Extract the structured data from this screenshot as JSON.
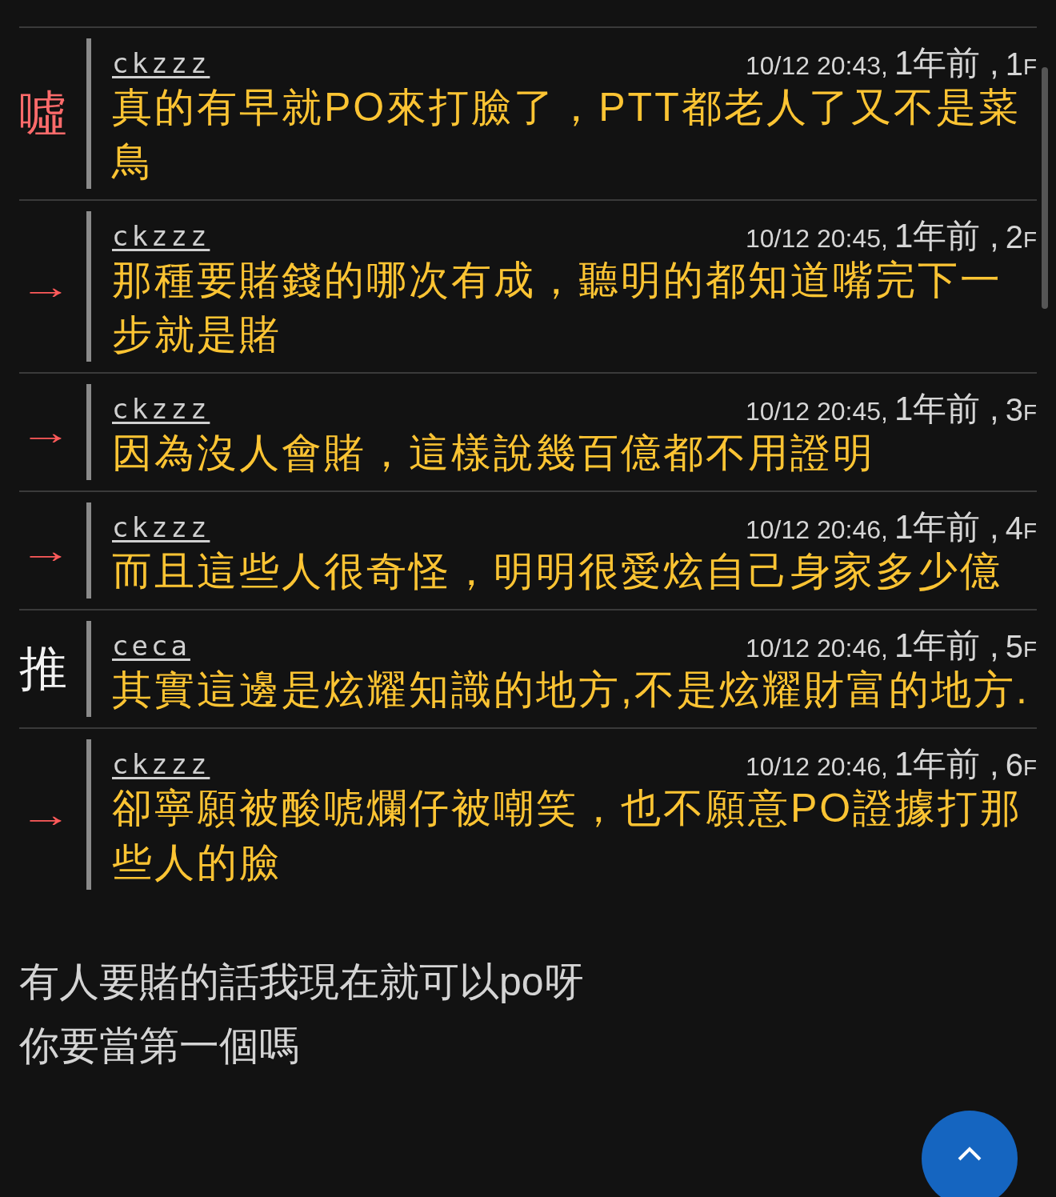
{
  "comments": [
    {
      "kind": "boo",
      "tag": "噓",
      "user": "ckzzz",
      "time": "10/12 20:43,",
      "age": "1年前 ,",
      "floor": "1",
      "floor_unit": "F",
      "text": "真的有早就PO來打臉了，PTT都老人了又不是菜鳥"
    },
    {
      "kind": "arrow",
      "tag": "→",
      "user": "ckzzz",
      "time": "10/12 20:45,",
      "age": "1年前 ,",
      "floor": "2",
      "floor_unit": "F",
      "text": "那種要賭錢的哪次有成，聽明的都知道嘴完下一步就是賭"
    },
    {
      "kind": "arrow",
      "tag": "→",
      "user": "ckzzz",
      "time": "10/12 20:45,",
      "age": "1年前 ,",
      "floor": "3",
      "floor_unit": "F",
      "text": "因為沒人會賭，這樣說幾百億都不用證明"
    },
    {
      "kind": "arrow",
      "tag": "→",
      "user": "ckzzz",
      "time": "10/12 20:46,",
      "age": "1年前 ,",
      "floor": "4",
      "floor_unit": "F",
      "text": "而且這些人很奇怪，明明很愛炫自己身家多少億"
    },
    {
      "kind": "push",
      "tag": "推",
      "user": "ceca",
      "time": "10/12 20:46,",
      "age": "1年前 ,",
      "floor": "5",
      "floor_unit": "F",
      "text": "其實這邊是炫耀知識的地方,不是炫耀財富的地方."
    },
    {
      "kind": "arrow",
      "tag": "→",
      "user": "ckzzz",
      "time": "10/12 20:46,",
      "age": "1年前 ,",
      "floor": "6",
      "floor_unit": "F",
      "text": "卻寧願被酸唬爛仔被嘲笑，也不願意PO證據打那些人的臉"
    }
  ],
  "footer_lines": [
    "有人要賭的話我現在就可以po呀",
    "你要當第一個嗎"
  ]
}
